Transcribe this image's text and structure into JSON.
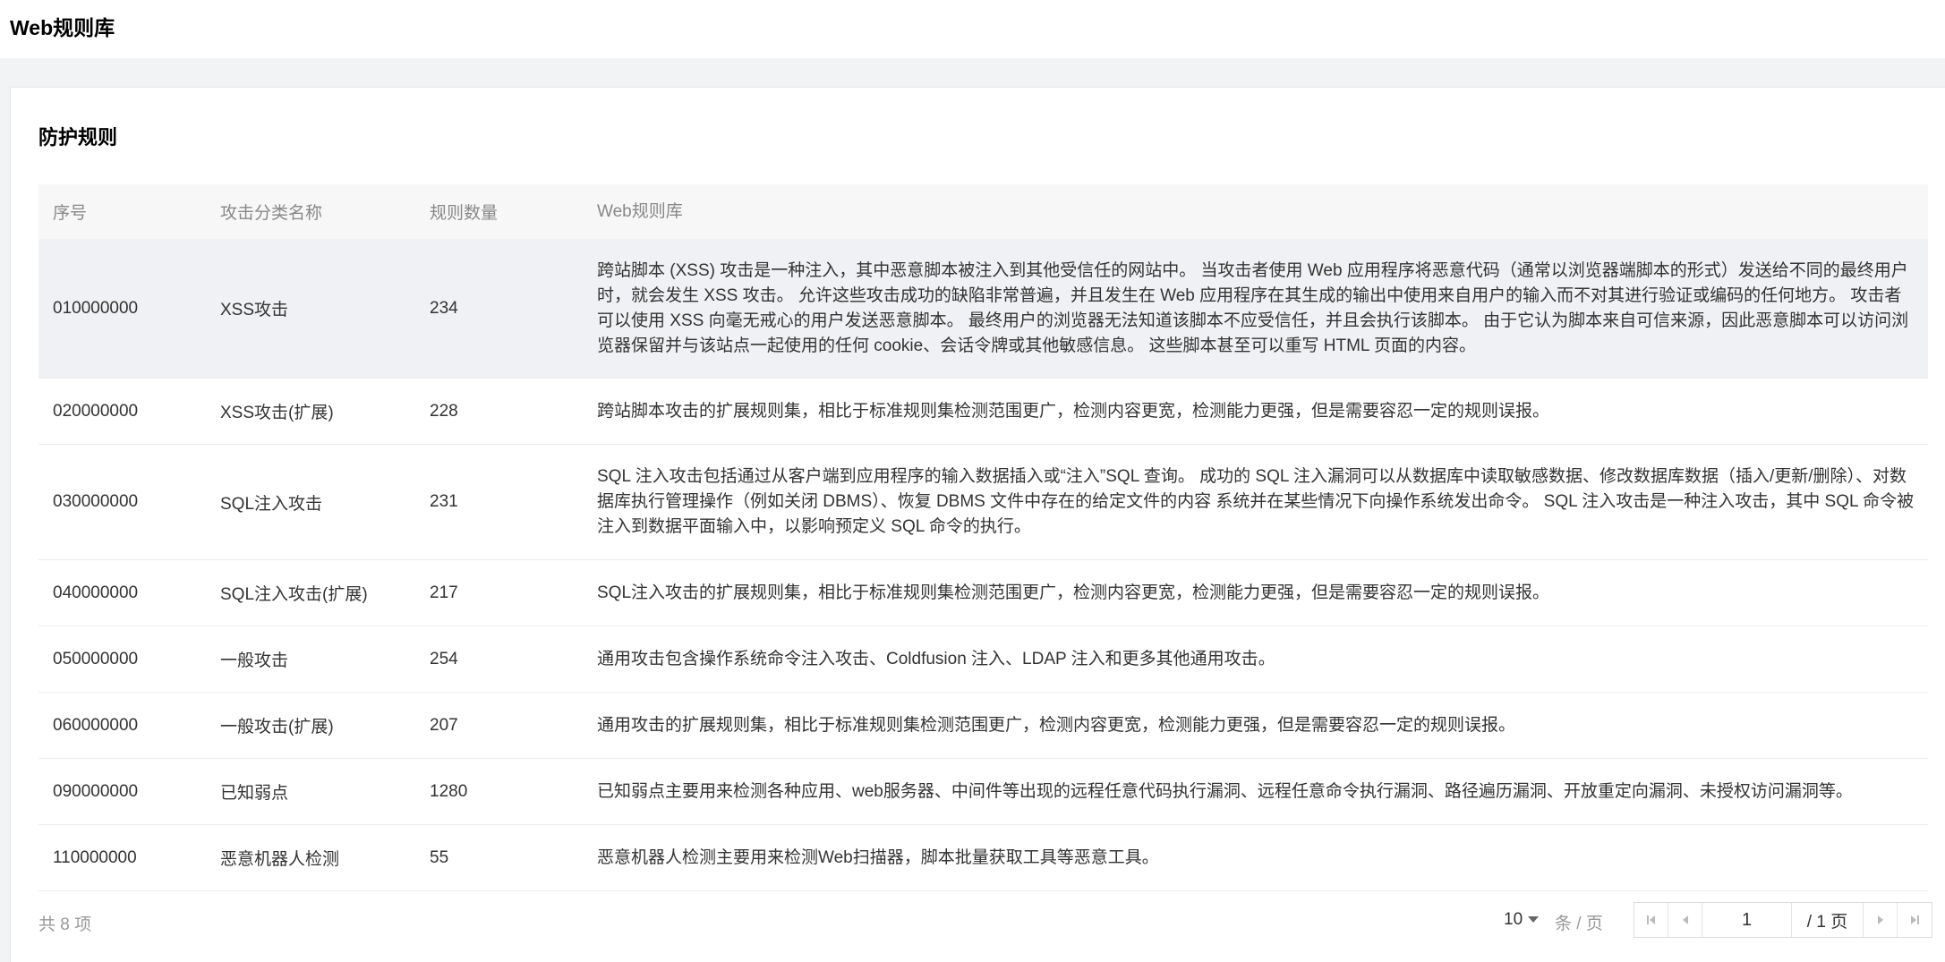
{
  "header": {
    "title": "Web规则库"
  },
  "panel": {
    "title": "防护规则"
  },
  "table": {
    "columns": [
      "序号",
      "攻击分类名称",
      "规则数量",
      "Web规则库"
    ],
    "rows": [
      {
        "id": "010000000",
        "name": "XSS攻击",
        "count": "234",
        "desc": "跨站脚本 (XSS) 攻击是一种注入，其中恶意脚本被注入到其他受信任的网站中。 当攻击者使用 Web 应用程序将恶意代码（通常以浏览器端脚本的形式）发送给不同的最终用户时，就会发生 XSS 攻击。 允许这些攻击成功的缺陷非常普遍，并且发生在 Web 应用程序在其生成的输出中使用来自用户的输入而不对其进行验证或编码的任何地方。 攻击者可以使用 XSS 向毫无戒心的用户发送恶意脚本。 最终用户的浏览器无法知道该脚本不应受信任，并且会执行该脚本。 由于它认为脚本来自可信来源，因此恶意脚本可以访问浏览器保留并与该站点一起使用的任何 cookie、会话令牌或其他敏感信息。 这些脚本甚至可以重写 HTML 页面的内容。"
      },
      {
        "id": "020000000",
        "name": "XSS攻击(扩展)",
        "count": "228",
        "desc": "跨站脚本攻击的扩展规则集，相比于标准规则集检测范围更广，检测内容更宽，检测能力更强，但是需要容忍一定的规则误报。"
      },
      {
        "id": "030000000",
        "name": "SQL注入攻击",
        "count": "231",
        "desc": "SQL 注入攻击包括通过从客户端到应用程序的输入数据插入或“注入”SQL 查询。 成功的 SQL 注入漏洞可以从数据库中读取敏感数据、修改数据库数据（插入/更新/删除）、对数据库执行管理操作（例如关闭 DBMS）、恢复 DBMS 文件中存在的给定文件的内容 系统并在某些情况下向操作系统发出命令。 SQL 注入攻击是一种注入攻击，其中 SQL 命令被注入到数据平面输入中，以影响预定义 SQL 命令的执行。"
      },
      {
        "id": "040000000",
        "name": "SQL注入攻击(扩展)",
        "count": "217",
        "desc": "SQL注入攻击的扩展规则集，相比于标准规则集检测范围更广，检测内容更宽，检测能力更强，但是需要容忍一定的规则误报。"
      },
      {
        "id": "050000000",
        "name": "一般攻击",
        "count": "254",
        "desc": "通用攻击包含操作系统命令注入攻击、Coldfusion 注入、LDAP 注入和更多其他通用攻击。"
      },
      {
        "id": "060000000",
        "name": "一般攻击(扩展)",
        "count": "207",
        "desc": "通用攻击的扩展规则集，相比于标准规则集检测范围更广，检测内容更宽，检测能力更强，但是需要容忍一定的规则误报。"
      },
      {
        "id": "090000000",
        "name": "已知弱点",
        "count": "1280",
        "desc": "已知弱点主要用来检测各种应用、web服务器、中间件等出现的远程任意代码执行漏洞、远程任意命令执行漏洞、路径遍历漏洞、开放重定向漏洞、未授权访问漏洞等。"
      },
      {
        "id": "110000000",
        "name": "恶意机器人检测",
        "count": "55",
        "desc": "恶意机器人检测主要用来检测Web扫描器，脚本批量获取工具等恶意工具。"
      }
    ]
  },
  "pagination": {
    "total_label": "共 8 项",
    "page_size": "10",
    "per_page_label": "条 / 页",
    "current_page": "1",
    "total_pages_label": "/ 1 页"
  }
}
